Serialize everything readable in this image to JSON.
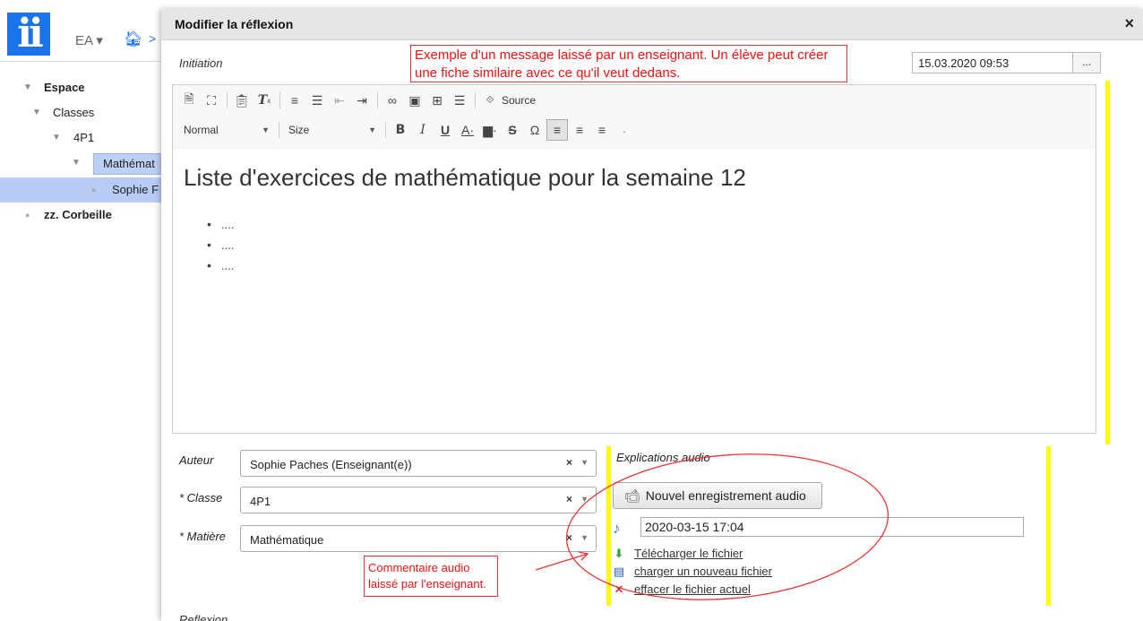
{
  "app": {
    "logo_text": "ii",
    "user_menu": "EA ▾",
    "breadcrumb_sep": ">"
  },
  "tree": {
    "espace": "Espace",
    "classes": "Classes",
    "class_4p1": "4P1",
    "subject": "Mathémat",
    "student": "Sophie F",
    "trash": "zz. Corbeille"
  },
  "modal": {
    "title": "Modifier la réflexion",
    "close": "×",
    "initiation_label": "Initiation",
    "date_value": "15.03.2020 09:53",
    "date_button": "...",
    "annotation_top": "Exemple d'un message laissé par un enseignant. Un élève peut créer une fiche similaire avec ce qu'il veut dedans."
  },
  "editor": {
    "source_label": "Source",
    "format_label": "Normal",
    "size_label": "Size",
    "heading": "Liste d'exercices de mathématique pour la semaine 12",
    "list_items": [
      "....",
      "....",
      "...."
    ]
  },
  "form": {
    "auteur_label": "Auteur",
    "auteur_value": "Sophie Paches (Enseignant(e))",
    "classe_label": "* Classe",
    "classe_value": "4P1",
    "matiere_label": "* Matière",
    "matiere_value": "Mathématique"
  },
  "audio": {
    "title": "Explications audio",
    "record_button": "Nouvel enregistrement audio",
    "file_value": "2020-03-15 17:04",
    "download_link": "Télécharger le fichier",
    "upload_link": "charger un nouveau fichier",
    "delete_link": "effacer le fichier actuel",
    "annotation": "Commentaire audio laissé par l'enseignant."
  },
  "reflexion_label": "Reflexion",
  "colors": {
    "accent": "#1a73e8",
    "annotation": "#e11111",
    "marker": "#ffff00",
    "tree_selected": "#b8ccf6"
  }
}
